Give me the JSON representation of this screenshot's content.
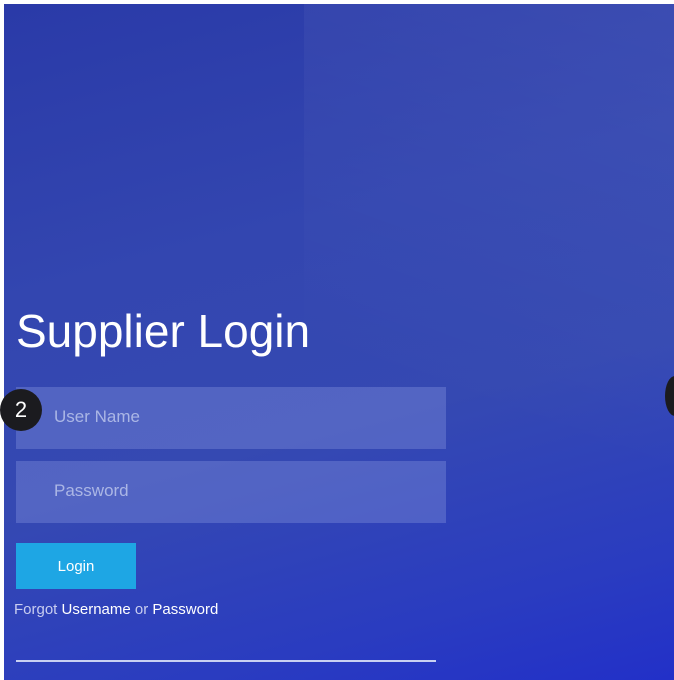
{
  "page": {
    "title": "Supplier Login"
  },
  "form": {
    "username_placeholder": "User Name",
    "password_placeholder": "Password",
    "login_label": "Login"
  },
  "forgot": {
    "prefix": "Forgot ",
    "username_link": "Username",
    "middle": " or ",
    "password_link": "Password"
  },
  "annotation": {
    "step_number": "2"
  },
  "colors": {
    "background": "#3346b0",
    "field_fill": "#6e7dd0",
    "button": "#1ea6e4",
    "badge": "#1b1b1f"
  }
}
